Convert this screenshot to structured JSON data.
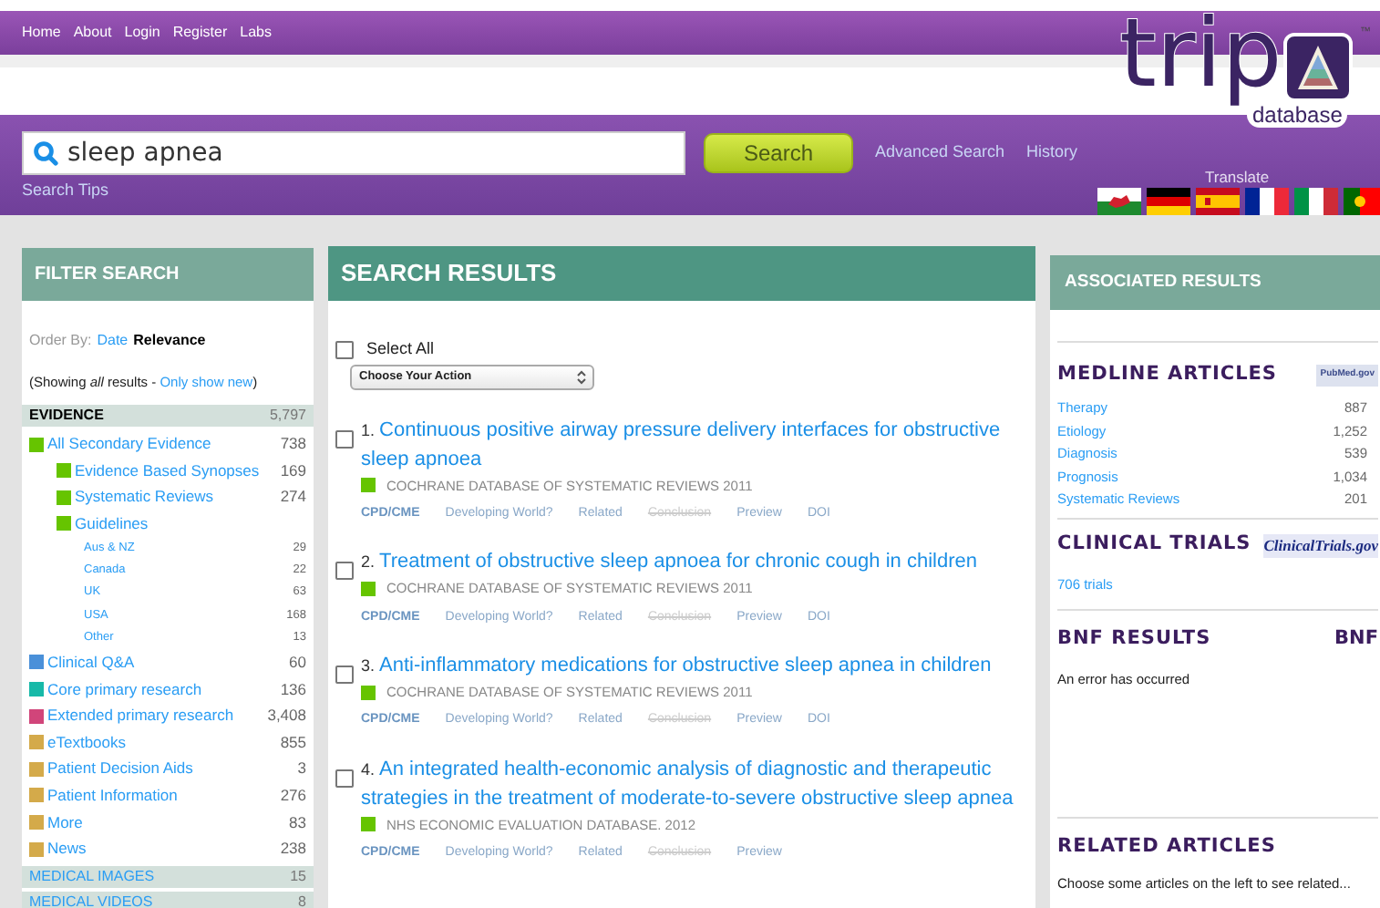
{
  "nav": [
    "Home",
    "About",
    "Login",
    "Register",
    "Labs"
  ],
  "logo": {
    "word": "trip",
    "sub": "database",
    "mark": "™"
  },
  "search": {
    "value": "sleep apnea",
    "button": "Search",
    "links": [
      "Advanced Search",
      "History"
    ],
    "tips": "Search Tips"
  },
  "translate": {
    "label": "Translate",
    "flags": [
      {
        "kind": "wales"
      },
      {
        "kind": "germany"
      },
      {
        "kind": "spain"
      },
      {
        "kind": "france"
      },
      {
        "kind": "italy"
      },
      {
        "kind": "portugal"
      }
    ]
  },
  "filter": {
    "title": "FILTER SEARCH",
    "order_label": "Order By:",
    "order_options": [
      {
        "label": "Date",
        "selected": false
      },
      {
        "label": "Relevance",
        "selected": true
      }
    ],
    "showing": {
      "prefix": "(Showing *all* results - ",
      "link": "Only show new",
      "suffix": ")"
    },
    "sections": [
      {
        "label": "EVIDENCE",
        "count": "5,797",
        "selected": true,
        "items": [
          {
            "label": "All Secondary Evidence",
            "count": "738",
            "color": "#66c400",
            "children": [
              {
                "label": "Evidence Based Synopses",
                "count": "169",
                "color": "#66c400"
              },
              {
                "label": "Systematic Reviews",
                "count": "274",
                "color": "#66c400"
              },
              {
                "label": "Guidelines",
                "color": "#66c400",
                "children": [
                  {
                    "label": "Aus & NZ",
                    "count": "29"
                  },
                  {
                    "label": "Canada",
                    "count": "22"
                  },
                  {
                    "label": "UK",
                    "count": "63"
                  },
                  {
                    "label": "USA",
                    "count": "168"
                  },
                  {
                    "label": "Other",
                    "count": "13"
                  }
                ]
              }
            ]
          },
          {
            "label": "Clinical Q&A",
            "count": "60",
            "color": "#4a90d9"
          },
          {
            "label": "Core primary research",
            "count": "136",
            "color": "#17b9a8"
          },
          {
            "label": "Extended primary research",
            "count": "3,408",
            "color": "#d1457a"
          },
          {
            "label": "eTextbooks",
            "count": "855",
            "color": "#d4aa4a"
          },
          {
            "label": "Patient Decision Aids",
            "count": "3",
            "color": "#d4aa4a"
          },
          {
            "label": "Patient Information",
            "count": "276",
            "color": "#d4aa4a"
          },
          {
            "label": "More",
            "count": "83",
            "color": "#d4aa4a"
          },
          {
            "label": "News",
            "count": "238",
            "color": "#d4aa4a"
          }
        ]
      },
      {
        "label": "MEDICAL IMAGES",
        "count": "15",
        "selected": false
      },
      {
        "label": "MEDICAL VIDEOS",
        "count": "8",
        "selected": false
      }
    ]
  },
  "results": {
    "title": "SEARCH RESULTS",
    "select_all": {
      "label": "Select All",
      "checked": false
    },
    "action": "Choose Your Action",
    "items": [
      {
        "number": "1.",
        "title": "Continuous positive airway pressure delivery interfaces for obstructive sleep apnoea",
        "source": "COCHRANE DATABASE OF SYSTEMATIC REVIEWS 2011",
        "color": "#66c400",
        "checked": false,
        "links": [
          {
            "label": "CPD/CME",
            "disabled": false
          },
          {
            "label": "Developing World?",
            "disabled": false
          },
          {
            "label": "Related",
            "disabled": false
          },
          {
            "label": "Conclusion",
            "disabled": true
          },
          {
            "label": "Preview",
            "disabled": false
          },
          {
            "label": "DOI",
            "disabled": false
          }
        ]
      },
      {
        "number": "2.",
        "title": "Treatment of obstructive sleep apnoea for chronic cough in children",
        "source": "COCHRANE DATABASE OF SYSTEMATIC REVIEWS 2011",
        "color": "#66c400",
        "checked": false,
        "links": [
          {
            "label": "CPD/CME",
            "disabled": false
          },
          {
            "label": "Developing World?",
            "disabled": false
          },
          {
            "label": "Related",
            "disabled": false
          },
          {
            "label": "Conclusion",
            "disabled": true
          },
          {
            "label": "Preview",
            "disabled": false
          },
          {
            "label": "DOI",
            "disabled": false
          }
        ]
      },
      {
        "number": "3.",
        "title": "Anti-inflammatory medications for obstructive sleep apnea in children",
        "source": "COCHRANE DATABASE OF SYSTEMATIC REVIEWS 2011",
        "color": "#66c400",
        "checked": false,
        "links": [
          {
            "label": "CPD/CME",
            "disabled": false
          },
          {
            "label": "Developing World?",
            "disabled": false
          },
          {
            "label": "Related",
            "disabled": false
          },
          {
            "label": "Conclusion",
            "disabled": true
          },
          {
            "label": "Preview",
            "disabled": false
          },
          {
            "label": "DOI",
            "disabled": false
          }
        ]
      },
      {
        "number": "4.",
        "title": "An integrated health-economic analysis of diagnostic and therapeutic strategies in the treatment of moderate-to-severe obstructive sleep apnea",
        "source": "NHS ECONOMIC EVALUATION DATABASE. 2012",
        "color": "#66c400",
        "checked": false,
        "links": [
          {
            "label": "CPD/CME",
            "disabled": false
          },
          {
            "label": "Developing World?",
            "disabled": false
          },
          {
            "label": "Related",
            "disabled": false
          },
          {
            "label": "Conclusion",
            "disabled": true
          },
          {
            "label": "Preview",
            "disabled": false
          }
        ]
      }
    ]
  },
  "associated": {
    "title": "ASSOCIATED RESULTS",
    "medline": {
      "title": "MEDLINE ARTICLES",
      "badge": "PubMed.gov",
      "rows": [
        {
          "label": "Therapy",
          "count": "887"
        },
        {
          "label": "Etiology",
          "count": "1,252"
        },
        {
          "label": "Diagnosis",
          "count": "539"
        },
        {
          "label": "Prognosis",
          "count": "1,034"
        },
        {
          "label": "Systematic Reviews",
          "count": "201"
        }
      ]
    },
    "trials": {
      "title": "CLINICAL TRIALS",
      "badge": "ClinicalTrials.gov",
      "link": "706 trials"
    },
    "bnf": {
      "title": "BNF RESULTS",
      "badge": "BNF",
      "message": "An error has occurred"
    },
    "related": {
      "title": "RELATED ARTICLES",
      "message": "Choose some articles on the left to see related..."
    }
  }
}
